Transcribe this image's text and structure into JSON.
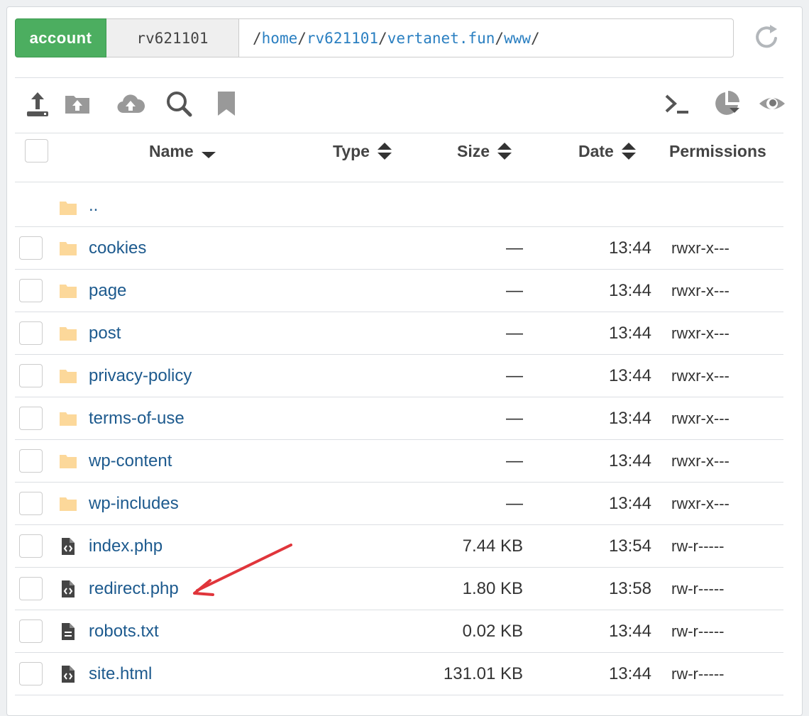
{
  "path_bar": {
    "account_label": "account",
    "user": "rv621101",
    "path_segments": [
      "home",
      "rv621101",
      "vertanet.fun",
      "www"
    ]
  },
  "toolbar": {
    "left_icons": [
      "upload-icon",
      "folder-upload-icon",
      "cloud-upload-icon",
      "search-icon",
      "bookmark-icon"
    ],
    "right_icons": [
      "terminal-icon",
      "pie-chart-icon",
      "eye-icon"
    ]
  },
  "table": {
    "headers": {
      "name": "Name",
      "type": "Type",
      "size": "Size",
      "date": "Date",
      "permissions": "Permissions"
    },
    "parent_dir": "..",
    "rows": [
      {
        "name": "cookies",
        "kind": "folder",
        "size": "—",
        "date": "13:44",
        "perms": "rwxr-x---"
      },
      {
        "name": "page",
        "kind": "folder",
        "size": "—",
        "date": "13:44",
        "perms": "rwxr-x---"
      },
      {
        "name": "post",
        "kind": "folder",
        "size": "—",
        "date": "13:44",
        "perms": "rwxr-x---"
      },
      {
        "name": "privacy-policy",
        "kind": "folder",
        "size": "—",
        "date": "13:44",
        "perms": "rwxr-x---"
      },
      {
        "name": "terms-of-use",
        "kind": "folder",
        "size": "—",
        "date": "13:44",
        "perms": "rwxr-x---"
      },
      {
        "name": "wp-content",
        "kind": "folder",
        "size": "—",
        "date": "13:44",
        "perms": "rwxr-x---"
      },
      {
        "name": "wp-includes",
        "kind": "folder",
        "size": "—",
        "date": "13:44",
        "perms": "rwxr-x---"
      },
      {
        "name": "index.php",
        "kind": "code",
        "size": "7.44 KB",
        "date": "13:54",
        "perms": "rw-r-----"
      },
      {
        "name": "redirect.php",
        "kind": "code",
        "size": "1.80 KB",
        "date": "13:58",
        "perms": "rw-r-----"
      },
      {
        "name": "robots.txt",
        "kind": "text",
        "size": "0.02 KB",
        "date": "13:44",
        "perms": "rw-r-----"
      },
      {
        "name": "site.html",
        "kind": "code",
        "size": "131.01 KB",
        "date": "13:44",
        "perms": "rw-r-----"
      }
    ]
  },
  "colors": {
    "account_green": "#4cae60",
    "link_blue": "#1d5a8e",
    "path_blue": "#2a7fc1",
    "folder_yellow": "#fcd89a",
    "annotation_red": "#e0353b"
  }
}
